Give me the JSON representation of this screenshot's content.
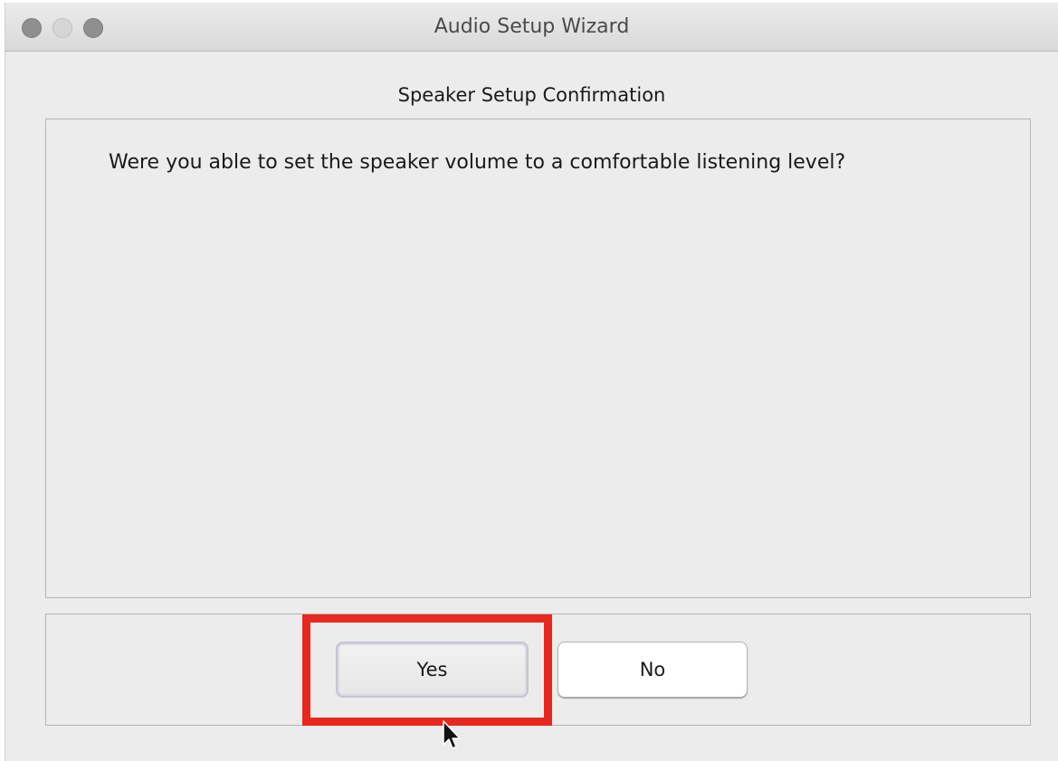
{
  "window": {
    "title": "Audio Setup Wizard"
  },
  "dialog": {
    "heading": "Speaker Setup Confirmation",
    "question": "Were you able to set the speaker volume to a comfortable listening level?"
  },
  "buttons": {
    "yes_label": "Yes",
    "no_label": "No"
  },
  "colors": {
    "highlight": "#e8281e",
    "window_background": "#ececec"
  },
  "icons": {
    "close": "close-icon",
    "minimize": "minimize-icon",
    "zoom": "zoom-icon",
    "cursor": "mouse-pointer-icon"
  }
}
